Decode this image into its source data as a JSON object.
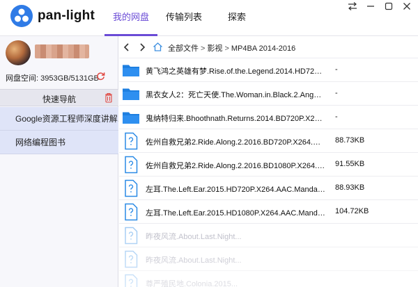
{
  "app": {
    "name": "pan-light",
    "accent": "#6a4bd6",
    "logo_icon": "triple-circle-logo"
  },
  "tabs": [
    {
      "label": "我的网盘",
      "active": true
    },
    {
      "label": "传输列表",
      "active": false
    },
    {
      "label": "探索",
      "active": false
    }
  ],
  "window_controls": [
    "swap-icon",
    "minimize-icon",
    "maximize-icon",
    "close-icon"
  ],
  "sidebar": {
    "quota_label": "网盘空间: 3953GB/5131GB",
    "quicknav_label": "快速导航",
    "items": [
      {
        "label": "Google资源工程师深度讲解..."
      },
      {
        "label": "网络编程图书"
      }
    ]
  },
  "pathbar": {
    "crumbs": [
      "全部文件",
      "影视",
      "MP4BA 2014-2016"
    ]
  },
  "files": [
    {
      "type": "folder",
      "name": "黄飞鸿之英雄有梦.Rise.of.the.Legend.2014.HD720P.X...",
      "size": "-"
    },
    {
      "type": "folder",
      "name": "黑衣女人2：死亡天使.The.Woman.in.Black.2.Angel.of....",
      "size": "-"
    },
    {
      "type": "folder",
      "name": "鬼纳特归来.Bhoothnath.Returns.2014.BD720P.X264....",
      "size": "-"
    },
    {
      "type": "file",
      "name": "佐州自救兄弟2.Ride.Along.2.2016.BD720P.X264.AAC....",
      "size": "88.73KB"
    },
    {
      "type": "file",
      "name": "佐州自救兄弟2.Ride.Along.2.2016.BD1080P.X264.AA...",
      "size": "91.55KB"
    },
    {
      "type": "file",
      "name": "左耳.The.Left.Ear.2015.HD720P.X264.AAC.Mandarin....",
      "size": "88.93KB"
    },
    {
      "type": "file",
      "name": "左耳.The.Left.Ear.2015.HD1080P.X264.AAC.Mandarin....",
      "size": "104.72KB"
    },
    {
      "type": "file",
      "name": "昨夜风流.About.Last.Night...",
      "size": ""
    },
    {
      "type": "file",
      "name": "昨夜风流.About.Last.Night...",
      "size": ""
    },
    {
      "type": "file",
      "name": "尊严殖民地.Colonia.2015...",
      "size": ""
    }
  ]
}
